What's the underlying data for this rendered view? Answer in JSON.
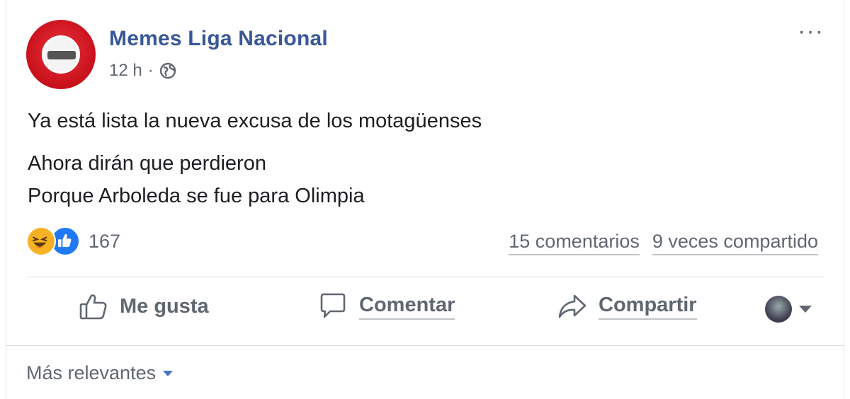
{
  "post": {
    "page_name": "Memes Liga Nacional",
    "time": "12 h",
    "separator": "·",
    "more_label": "···",
    "text_line_1": "Ya está lista la nueva excusa de los motagüenses",
    "text_line_2": "Ahora dirán que perdieron",
    "text_line_3": "Porque Arboleda se fue para Olimpia"
  },
  "stats": {
    "reaction_icons": [
      "haha-icon",
      "like-icon"
    ],
    "reaction_count": "167",
    "comments": "15 comentarios",
    "shares": "9 veces compartido"
  },
  "actions": {
    "like_label": "Me gusta",
    "comment_label": "Comentar",
    "share_label": "Compartir"
  },
  "comments_sort": {
    "label": "Más relevantes"
  },
  "colors": {
    "page_name": "#385898",
    "secondary_text": "#606770",
    "body_text": "#1c1e21",
    "like_blue": "#2078f4",
    "haha_yellow": "#f7b125",
    "avatar_red": "#c8101b"
  }
}
